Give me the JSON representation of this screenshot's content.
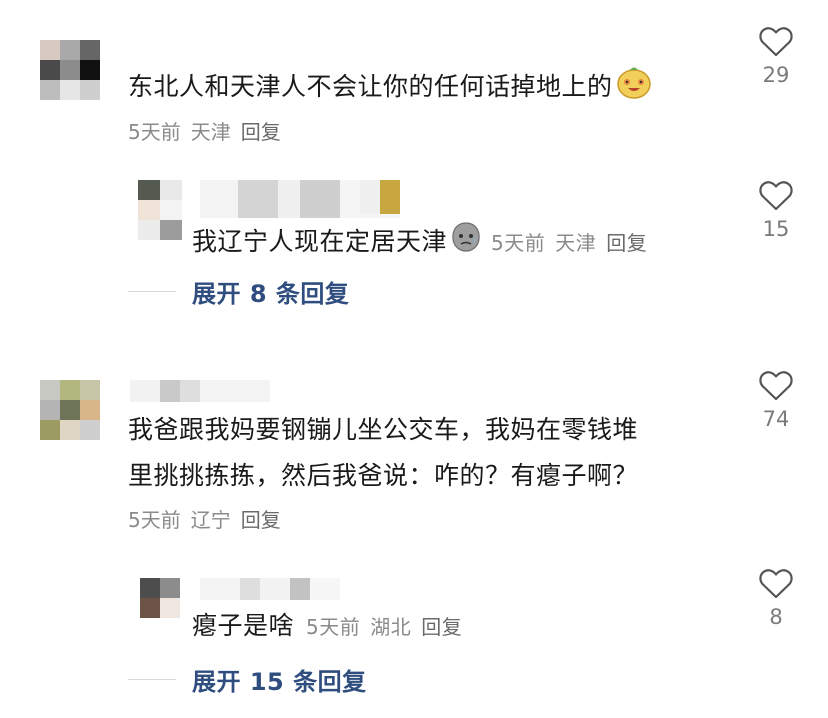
{
  "comments": [
    {
      "text": "东北人和天津人不会让你的任何话掉地上的",
      "time": "5天前",
      "location": "天津",
      "reply_label": "回复",
      "likes": "29",
      "emoji": "grinning-face-emoji"
    },
    {
      "text": "我辽宁人现在定居天津",
      "time": "5天前",
      "location": "天津",
      "reply_label": "回复",
      "likes": "15",
      "emoji": "pensive-face-emoji"
    },
    {
      "text_line1": "我爸跟我妈要钢镚儿坐公交车，我妈在零钱堆",
      "text_line2": "里挑挑拣拣，然后我爸说：咋的？有瘪子啊？",
      "time": "5天前",
      "location": "辽宁",
      "reply_label": "回复",
      "likes": "74"
    },
    {
      "text": "瘪子是啥",
      "time": "5天前",
      "location": "湖北",
      "reply_label": "回复",
      "likes": "8"
    }
  ],
  "expand_replies": [
    {
      "label": "展开 8 条回复"
    },
    {
      "label": "展开 15 条回复"
    }
  ],
  "colors": {
    "text": "#1a1a1a",
    "meta": "#8a8a8a",
    "expand_link": "#2f4e7f",
    "heart_outline": "#555555"
  },
  "icons": {
    "like": "heart-outline-icon"
  }
}
